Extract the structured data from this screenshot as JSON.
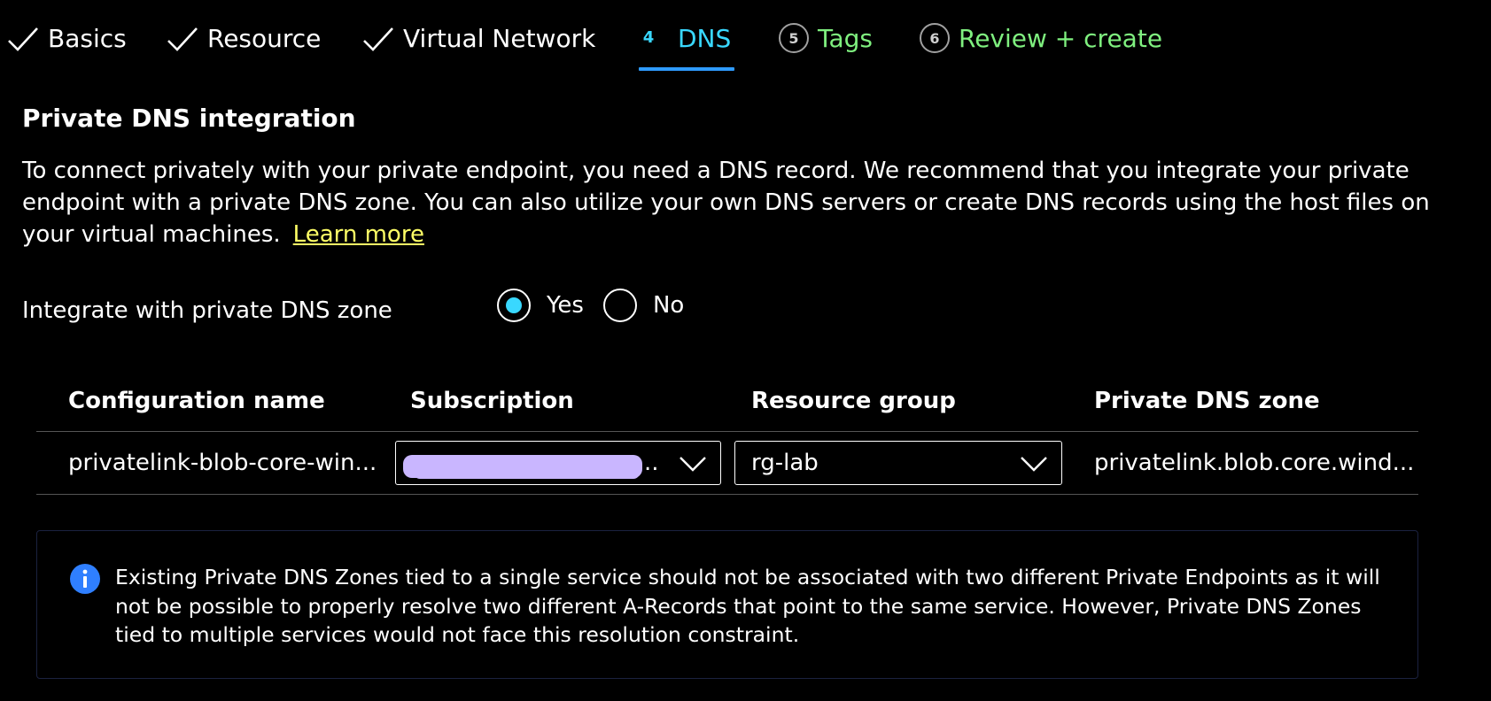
{
  "tabs": [
    {
      "label": "Basics",
      "state": "done"
    },
    {
      "label": "Resource",
      "state": "done"
    },
    {
      "label": "Virtual Network",
      "state": "done"
    },
    {
      "number": "4",
      "label": "DNS",
      "state": "active"
    },
    {
      "number": "5",
      "label": "Tags",
      "state": "next"
    },
    {
      "number": "6",
      "label": "Review + create",
      "state": "next"
    }
  ],
  "section": {
    "title": "Private DNS integration",
    "description": "To connect privately with your private endpoint, you need a DNS record. We recommend that you integrate your private endpoint with a private DNS zone. You can also utilize your own DNS servers or create DNS records using the host files on your virtual machines.",
    "learn_more": "Learn more"
  },
  "integrate": {
    "label": "Integrate with private DNS zone",
    "options": [
      "Yes",
      "No"
    ],
    "selected": "Yes"
  },
  "table": {
    "headers": [
      "Configuration name",
      "Subscription",
      "Resource group",
      "Private DNS zone"
    ],
    "rows": [
      {
        "configuration_name": "privatelink-blob-core-win...",
        "subscription": "..",
        "resource_group": "rg-lab",
        "private_dns_zone": "privatelink.blob.core.wind..."
      }
    ]
  },
  "info": {
    "text": "Existing Private DNS Zones tied to a single service should not be associated with two different Private Endpoints as it will not be possible to properly resolve two different A-Records that point to the same service. However, Private DNS Zones tied to multiple services would not face this resolution constraint."
  },
  "colors": {
    "background": "#000000",
    "active_tab": "#39d8ff",
    "next_tab": "#7ff07f",
    "underline": "#2f9bff",
    "link": "#ffff66",
    "radio_selected": "#39d8ff",
    "info_icon": "#2f7fff",
    "redaction": "#c9b6ff"
  }
}
